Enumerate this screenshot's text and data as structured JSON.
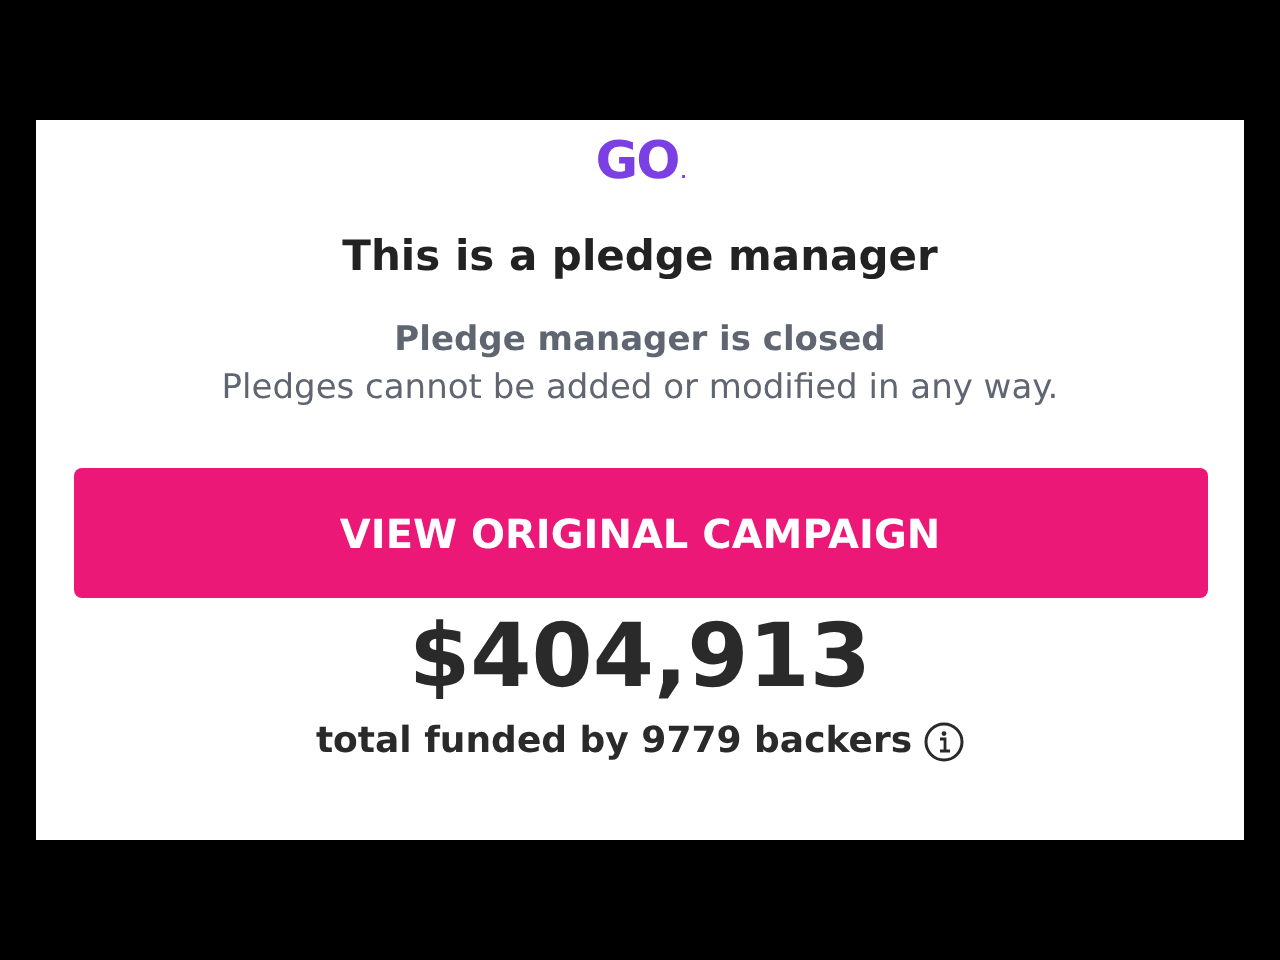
{
  "logo": {
    "text": "GO",
    "mark": "."
  },
  "heading": "This is a pledge manager",
  "status": {
    "title": "Pledge manager is closed",
    "message": "Pledges cannot be added or modified in any way."
  },
  "button": {
    "label": "VIEW ORIGINAL CAMPAIGN"
  },
  "total": {
    "amount": "$404,913",
    "caption": "total funded by 9779 backers"
  }
}
